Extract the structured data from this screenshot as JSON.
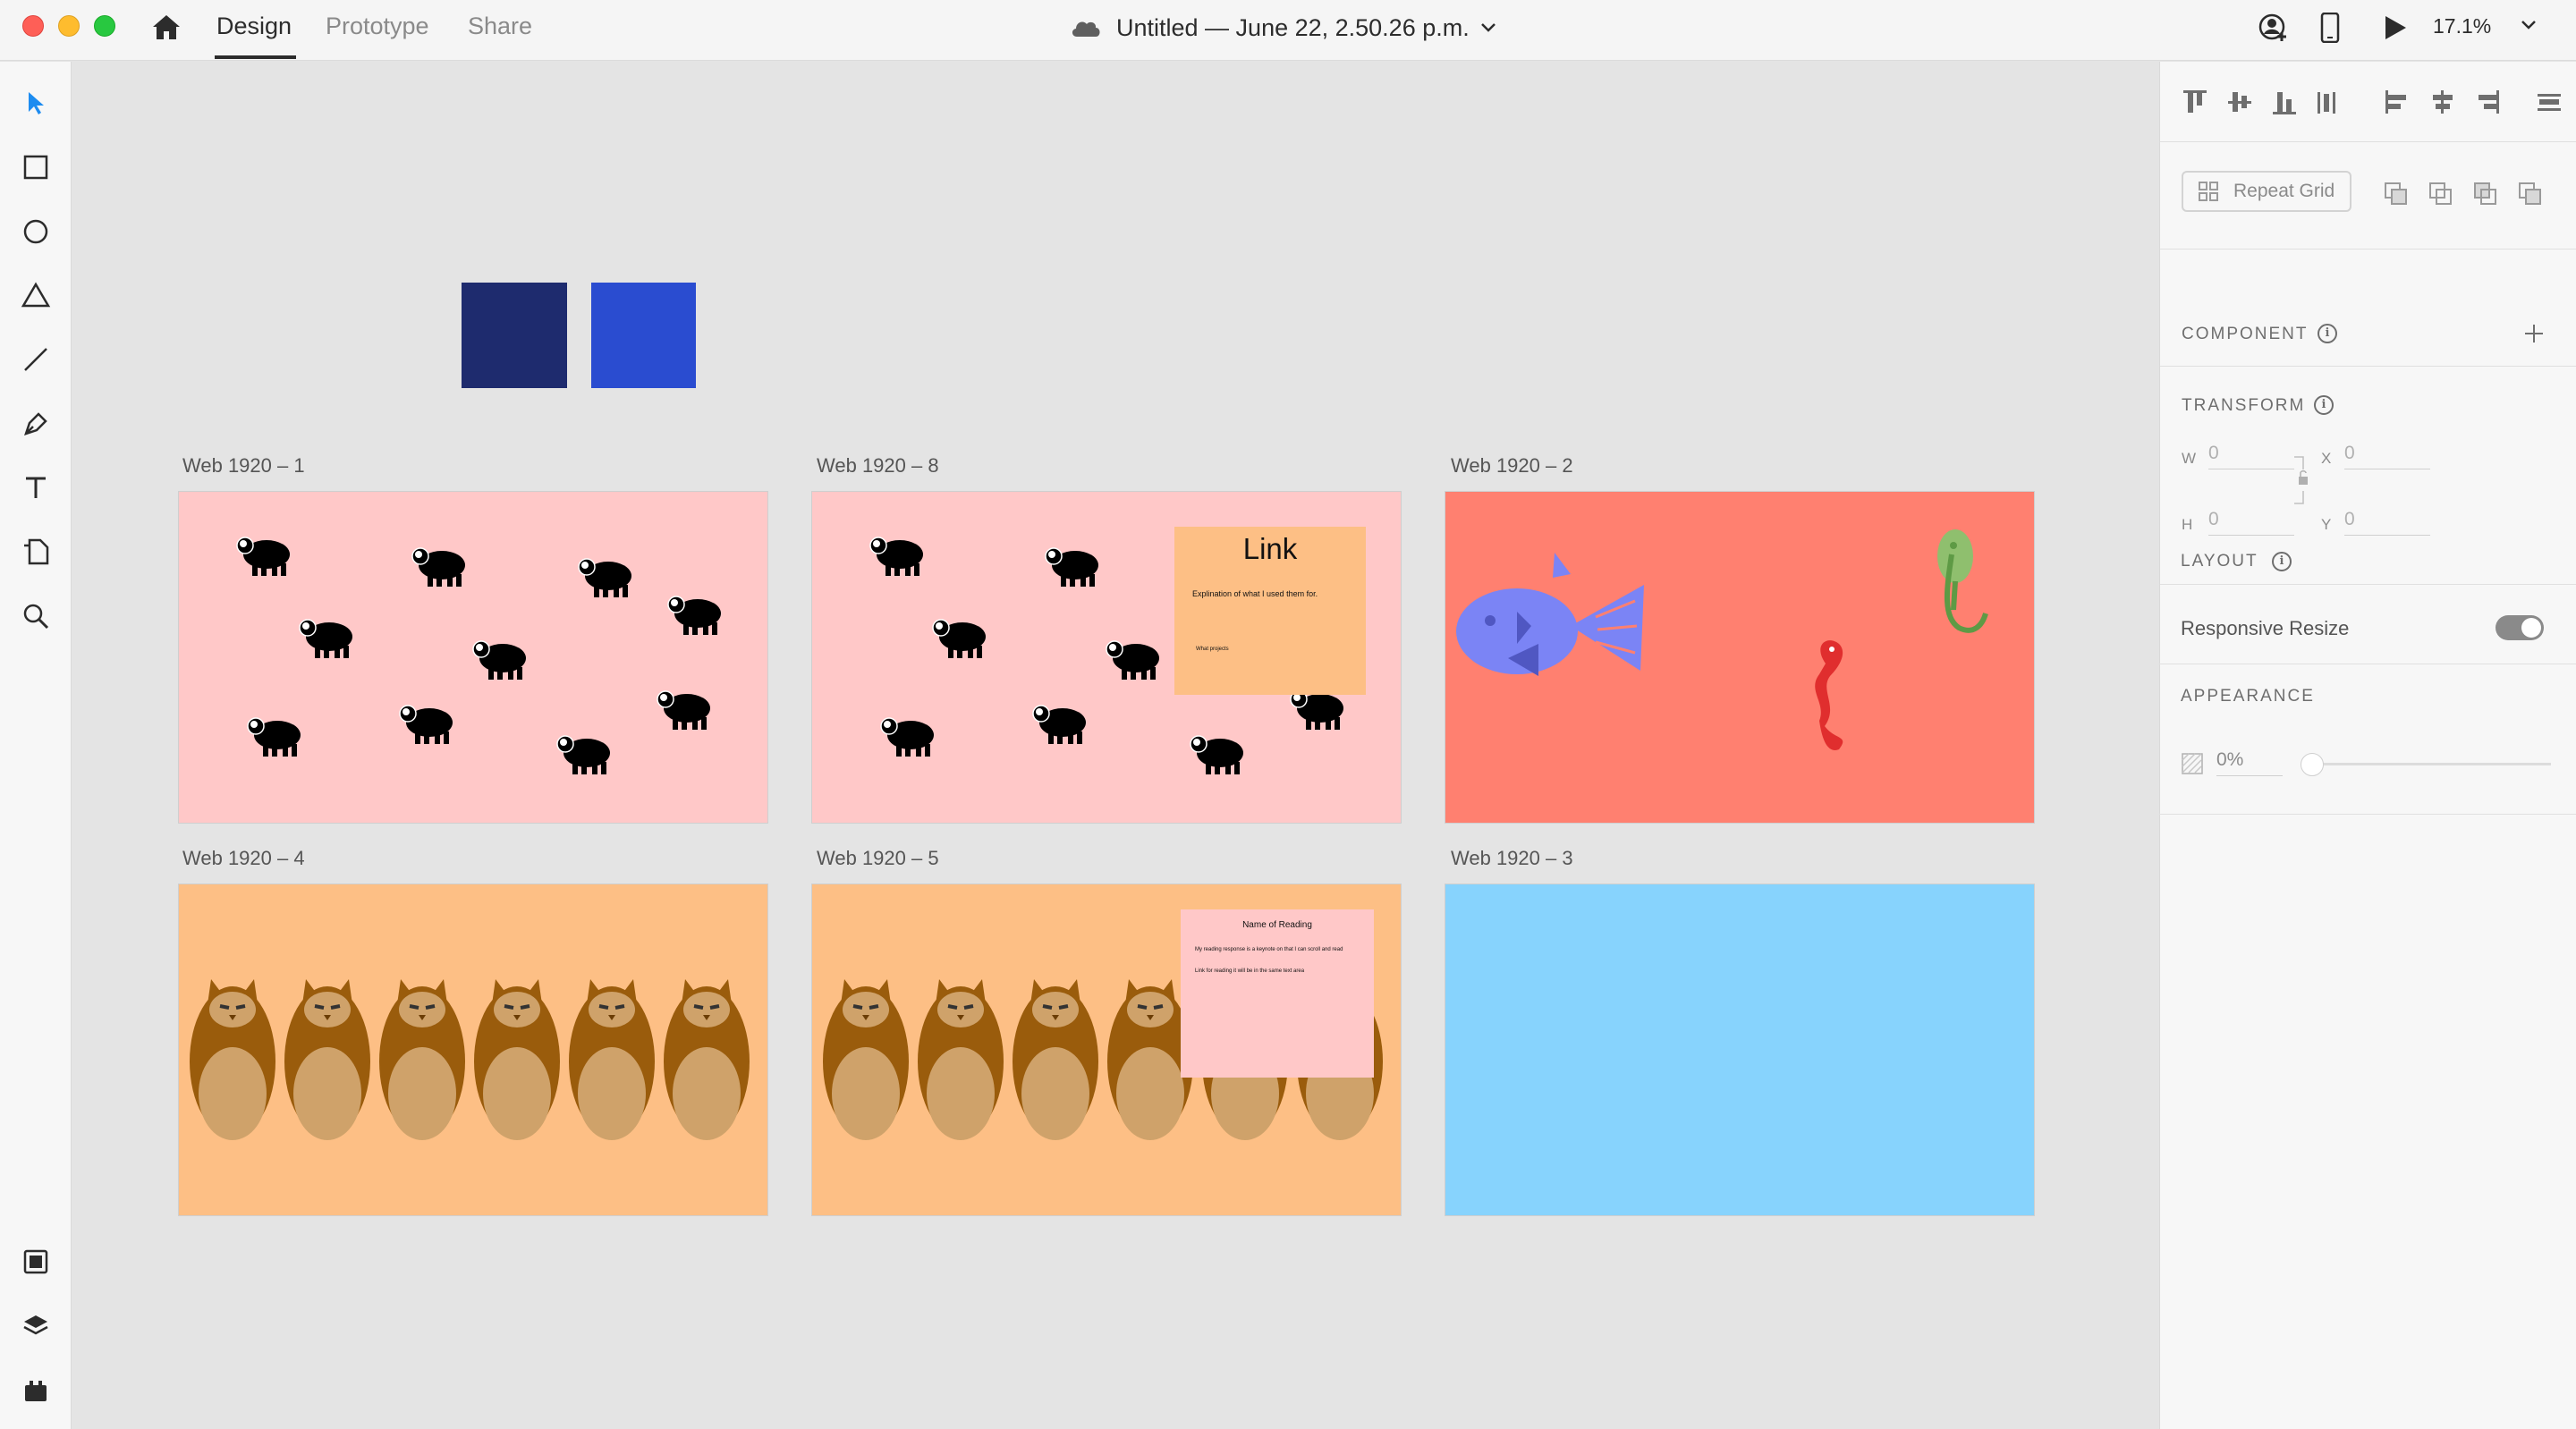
{
  "titlebar": {
    "tabs": [
      "Design",
      "Prototype",
      "Share"
    ],
    "doc_title": "Untitled — June 22, 2.50.26 p.m.",
    "zoom": "17.1%"
  },
  "icons": {
    "home": "home-icon",
    "cloud": "cloud-icon",
    "share_user": "user-add-icon",
    "device": "mobile-preview-icon",
    "play": "play-icon"
  },
  "left_tools": [
    "select",
    "rectangle",
    "ellipse",
    "polygon",
    "line",
    "pen",
    "text",
    "artboard",
    "zoom",
    "assets",
    "layers",
    "plugins"
  ],
  "canvas": {
    "squares": [
      {
        "color": "#1e2b6e"
      },
      {
        "color": "#2a4cd0"
      }
    ],
    "artboards": [
      {
        "label": "Web 1920 – 1",
        "bg": "#ffc8c8",
        "content": "sheep"
      },
      {
        "label": "Web 1920 – 8",
        "bg": "#ffc8c8",
        "content": "sheep"
      },
      {
        "label": "Web 1920 – 2",
        "bg": "#ff8070",
        "content": "sea"
      },
      {
        "label": "Web 1920 – 4",
        "bg": "#fdbf85",
        "content": "owls"
      },
      {
        "label": "Web 1920 – 5",
        "bg": "#fdbf85",
        "content": "owls"
      },
      {
        "label": "Web 1920 – 3",
        "bg": "#87d3fd",
        "content": "empty"
      }
    ],
    "note_link": {
      "title": "Link",
      "body": "Explination of what I used them for.",
      "footer": "What projects"
    },
    "note_reading": {
      "title": "Name of Reading",
      "line1": "My reading response is a keynote on that I can scroll and read",
      "line2": "Link for reading it will be in the same text area"
    }
  },
  "panel": {
    "repeat_grid": "Repeat Grid",
    "component_title": "COMPONENT",
    "transform_title": "TRANSFORM",
    "w_label": "W",
    "w_value": "0",
    "x_label": "X",
    "x_value": "0",
    "h_label": "H",
    "h_value": "0",
    "y_label": "Y",
    "y_value": "0",
    "layout_title": "LAYOUT",
    "responsive_resize": "Responsive Resize",
    "responsive_on": true,
    "appearance_title": "APPEARANCE",
    "opacity": "0%"
  }
}
